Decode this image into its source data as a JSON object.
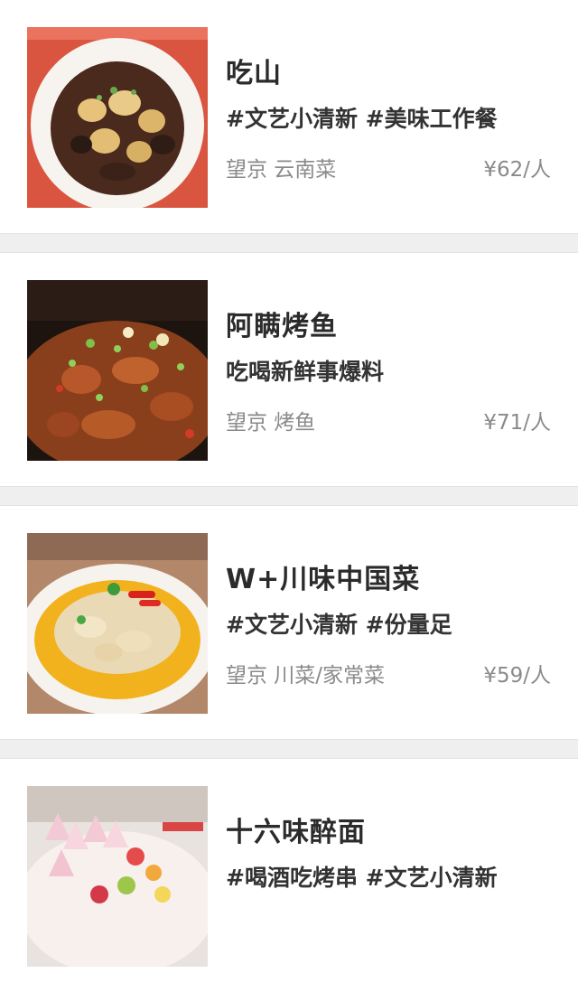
{
  "restaurants": [
    {
      "name": "吃山",
      "tags": "#文艺小清新 #美味工作餐",
      "meta": "望京 云南菜",
      "price": "¥62/人"
    },
    {
      "name": "阿瞒烤鱼",
      "tags": "吃喝新鲜事爆料",
      "meta": "望京 烤鱼",
      "price": "¥71/人"
    },
    {
      "name": "W+川味中国菜",
      "tags": "#文艺小清新 #份量足",
      "meta": "望京 川菜/家常菜",
      "price": "¥59/人"
    },
    {
      "name": "十六味醉面",
      "tags": "#喝酒吃烤串 #文艺小清新",
      "meta": "",
      "price": ""
    }
  ]
}
